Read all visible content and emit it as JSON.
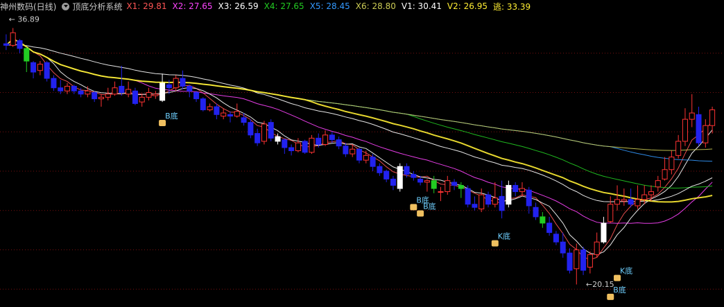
{
  "header": {
    "symbol": "神州数码(日线)",
    "system": "顶底分析系统",
    "indicators": [
      {
        "label": "X1: 29.81",
        "color": "#ff5555"
      },
      {
        "label": "X2: 27.65",
        "color": "#ff44ff"
      },
      {
        "label": "X3: 26.59",
        "color": "#ffffff"
      },
      {
        "label": "X4: 27.65",
        "color": "#22cc22"
      },
      {
        "label": "X5: 28.45",
        "color": "#3399ff"
      },
      {
        "label": "X6: 28.80",
        "color": "#cccc55"
      },
      {
        "label": "V1: 30.41",
        "color": "#ffffff"
      },
      {
        "label": "V2: 26.95",
        "color": "#ffee33"
      },
      {
        "label": "逃: 33.39",
        "color": "#ffee33"
      }
    ]
  },
  "chart_data": {
    "type": "candlestick",
    "ylim": [
      19.0,
      37.5
    ],
    "high_label": "36.89",
    "low_label": "20.15",
    "candles": [
      [
        35.6,
        35.5,
        36.2,
        35.2
      ],
      [
        35.5,
        36.3,
        36.6,
        35.4
      ],
      [
        35.8,
        35.3,
        35.9,
        35.0
      ],
      [
        35.3,
        34.5,
        35.4,
        33.8
      ],
      [
        34.4,
        33.8,
        34.5,
        33.4
      ],
      [
        33.9,
        34.3,
        34.5,
        33.6
      ],
      [
        34.4,
        33.4,
        34.5,
        33.2
      ],
      [
        33.4,
        32.8,
        33.6,
        32.6
      ],
      [
        32.8,
        32.6,
        33.3,
        32.4
      ],
      [
        32.6,
        32.9,
        33.1,
        32.4
      ],
      [
        32.9,
        32.6,
        33.0,
        32.4
      ],
      [
        32.6,
        32.4,
        32.8,
        32.2
      ],
      [
        32.4,
        32.6,
        32.9,
        32.2
      ],
      [
        32.5,
        32.1,
        32.6,
        31.9
      ],
      [
        32.1,
        32.2,
        32.4,
        31.6
      ],
      [
        32.2,
        32.4,
        32.8,
        32.0
      ],
      [
        32.4,
        32.8,
        33.2,
        32.3
      ],
      [
        32.9,
        32.5,
        34.2,
        32.3
      ],
      [
        32.4,
        32.7,
        33.2,
        32.2
      ],
      [
        32.6,
        31.8,
        32.8,
        31.7
      ],
      [
        31.9,
        32.2,
        32.4,
        31.6
      ],
      [
        32.2,
        32.5,
        32.8,
        32.0
      ],
      [
        32.3,
        32.4,
        32.6,
        32.1
      ],
      [
        32.0,
        33.1,
        33.7,
        31.9
      ],
      [
        33.0,
        32.8,
        33.3,
        32.4
      ],
      [
        32.8,
        33.4,
        33.6,
        32.6
      ],
      [
        33.4,
        32.9,
        33.9,
        32.7
      ],
      [
        32.9,
        32.6,
        33.0,
        32.2
      ],
      [
        32.5,
        32.1,
        32.6,
        31.9
      ],
      [
        32.1,
        31.4,
        32.2,
        31.3
      ],
      [
        31.4,
        31.6,
        31.8,
        31.3
      ],
      [
        31.6,
        31.1,
        31.8,
        30.8
      ],
      [
        31.0,
        31.2,
        31.5,
        30.8
      ],
      [
        31.1,
        31.0,
        31.3,
        30.6
      ],
      [
        31.0,
        31.3,
        31.8,
        30.9
      ],
      [
        30.9,
        30.6,
        31.2,
        30.4
      ],
      [
        30.6,
        29.8,
        30.8,
        29.6
      ],
      [
        29.9,
        29.3,
        30.2,
        29.1
      ],
      [
        29.4,
        30.5,
        30.7,
        29.2
      ],
      [
        30.6,
        29.6,
        30.8,
        29.4
      ],
      [
        29.7,
        29.4,
        29.9,
        29.2
      ],
      [
        29.5,
        29.0,
        29.6,
        28.6
      ],
      [
        29.0,
        28.8,
        29.2,
        28.5
      ],
      [
        28.8,
        29.3,
        29.6,
        28.7
      ],
      [
        29.4,
        28.7,
        29.5,
        28.6
      ],
      [
        28.7,
        29.6,
        29.8,
        28.6
      ],
      [
        29.6,
        29.2,
        29.9,
        29.0
      ],
      [
        29.2,
        29.8,
        30.1,
        29.1
      ],
      [
        29.8,
        29.5,
        30.0,
        29.3
      ],
      [
        29.5,
        29.1,
        29.7,
        28.9
      ],
      [
        29.1,
        28.6,
        29.3,
        28.4
      ],
      [
        28.6,
        28.9,
        29.2,
        28.4
      ],
      [
        28.9,
        28.2,
        29.0,
        28.0
      ],
      [
        28.2,
        28.5,
        28.8,
        28.0
      ],
      [
        28.4,
        27.8,
        28.6,
        27.5
      ],
      [
        27.8,
        27.4,
        28.0,
        27.2
      ],
      [
        27.5,
        27.0,
        27.6,
        26.8
      ],
      [
        27.0,
        26.6,
        27.2,
        26.3
      ],
      [
        26.4,
        27.8,
        28.0,
        26.2
      ],
      [
        27.8,
        27.3,
        28.0,
        27.1
      ],
      [
        27.3,
        27.1,
        27.5,
        26.9
      ],
      [
        27.0,
        26.8,
        27.2,
        26.6
      ],
      [
        26.8,
        26.9,
        27.0,
        26.2
      ],
      [
        26.9,
        26.4,
        27.2,
        26.1
      ],
      [
        26.2,
        26.2,
        26.5,
        25.6
      ],
      [
        26.2,
        26.9,
        27.2,
        26.0
      ],
      [
        26.8,
        26.6,
        27.0,
        26.3
      ],
      [
        26.6,
        26.4,
        26.8,
        25.8
      ],
      [
        26.4,
        25.4,
        26.6,
        25.2
      ],
      [
        25.4,
        25.2,
        25.9,
        25.0
      ],
      [
        25.1,
        26.0,
        26.4,
        24.9
      ],
      [
        26.0,
        25.4,
        26.2,
        25.2
      ],
      [
        25.4,
        25.8,
        26.8,
        25.2
      ],
      [
        25.9,
        25.0,
        26.9,
        24.5
      ],
      [
        25.4,
        26.6,
        26.9,
        25.2
      ],
      [
        26.6,
        26.2,
        26.8,
        25.9
      ],
      [
        26.2,
        26.4,
        26.8,
        25.9
      ],
      [
        26.3,
        25.3,
        26.5,
        24.8
      ],
      [
        25.2,
        24.6,
        25.5,
        24.4
      ],
      [
        24.6,
        24.2,
        24.9,
        23.9
      ],
      [
        24.2,
        23.6,
        24.6,
        23.4
      ],
      [
        23.5,
        23.0,
        23.7,
        22.8
      ],
      [
        23.0,
        22.3,
        23.6,
        22.0
      ],
      [
        22.3,
        21.2,
        22.6,
        21.0
      ],
      [
        21.3,
        22.5,
        22.9,
        20.3
      ],
      [
        22.5,
        21.2,
        22.7,
        20.9
      ],
      [
        21.4,
        22.2,
        22.4,
        21.0
      ],
      [
        22.2,
        23.0,
        23.6,
        22.0
      ],
      [
        23.0,
        24.2,
        24.6,
        22.9
      ],
      [
        24.3,
        25.4,
        25.9,
        24.2
      ],
      [
        25.4,
        25.7,
        26.6,
        25.0
      ],
      [
        25.6,
        25.7,
        26.4,
        25.3
      ],
      [
        25.7,
        25.4,
        26.4,
        25.2
      ],
      [
        25.3,
        25.7,
        26.6,
        25.1
      ],
      [
        25.7,
        26.0,
        26.6,
        25.4
      ],
      [
        26.0,
        26.2,
        26.6,
        25.6
      ],
      [
        26.5,
        26.9,
        27.2,
        26.2
      ],
      [
        27.0,
        27.6,
        28.4,
        26.9
      ],
      [
        27.6,
        28.4,
        28.8,
        27.3
      ],
      [
        28.5,
        29.4,
        29.8,
        28.3
      ],
      [
        29.4,
        30.8,
        31.5,
        29.1
      ],
      [
        30.8,
        31.2,
        32.4,
        30.3
      ],
      [
        31.1,
        29.3,
        31.6,
        29.1
      ],
      [
        29.3,
        30.4,
        30.8,
        29.0
      ],
      [
        30.4,
        31.4,
        31.6,
        29.9
      ]
    ],
    "series": [
      {
        "name": "X1",
        "color": "#ff5555"
      },
      {
        "name": "X2",
        "color": "#ff44ff"
      },
      {
        "name": "X3",
        "color": "#ffffff"
      },
      {
        "name": "X4",
        "color": "#22cc22"
      },
      {
        "name": "X5",
        "color": "#3399ff"
      },
      {
        "name": "X6",
        "color": "#cccc55"
      },
      {
        "name": "V1",
        "color": "#ffffff"
      },
      {
        "name": "V2",
        "color": "#ffee33"
      }
    ],
    "annotations": [
      {
        "text": "B底",
        "index": 23,
        "price": 30.85,
        "color": "#6fd0ff"
      },
      {
        "text": "B底",
        "index": 60,
        "price": 25.5,
        "color": "#6fd0ff"
      },
      {
        "text": "B底",
        "index": 61,
        "price": 25.1,
        "color": "#6fd0ff"
      },
      {
        "text": "K底",
        "index": 72,
        "price": 23.2,
        "color": "#6fd0ff"
      },
      {
        "text": "K底",
        "index": 90,
        "price": 21.0,
        "color": "#6fd0ff"
      },
      {
        "text": "B底",
        "index": 89,
        "price": 19.8,
        "color": "#6fd0ff"
      }
    ],
    "colors": {
      "up": "#ff3333",
      "down": "#2222ee",
      "up_green": "#22cc22",
      "white": "#ffffff",
      "grid": "#7a1010",
      "label": "#ff5555",
      "badge": "#f0c060"
    }
  }
}
